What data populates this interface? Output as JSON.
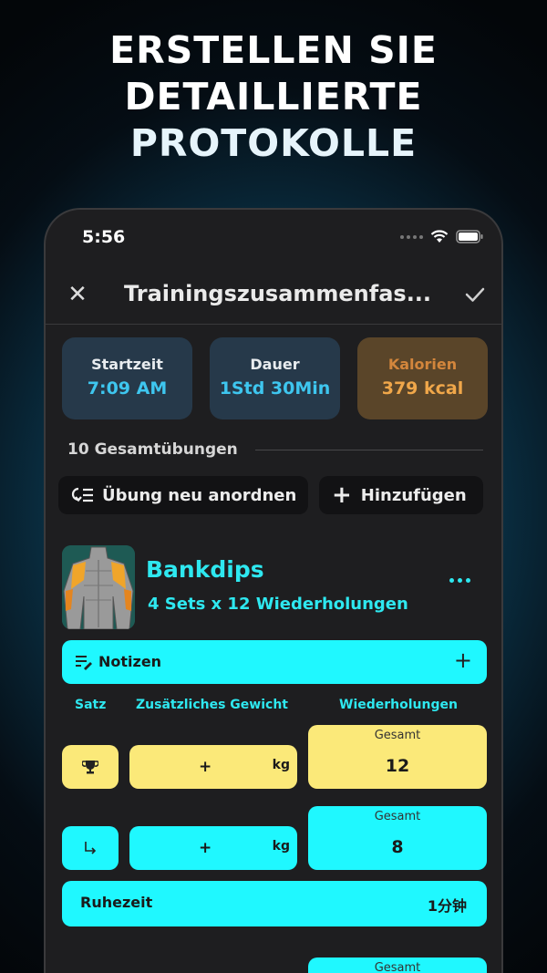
{
  "headline": {
    "line1": "ERSTELLEN SIE",
    "line2": "DETAILLIERTE",
    "line3": "PROTOKOLLE"
  },
  "status_bar": {
    "time": "5:56"
  },
  "nav": {
    "title": "Trainingszusammenfas..."
  },
  "stats": [
    {
      "label": "Startzeit",
      "value": "7:09 AM"
    },
    {
      "label": "Dauer",
      "value": "1Std 30Min"
    },
    {
      "label": "Kalorien",
      "value": "379 kcal"
    }
  ],
  "section_title": "10 Gesamtübungen",
  "actions": {
    "reorder_label": "Übung neu anordnen",
    "add_label": "Hinzufügen"
  },
  "exercise": {
    "name": "Bankdips",
    "sets_summary": "4 Sets x 12 Wiederholungen",
    "notes_label": "Notizen",
    "columns": {
      "set": "Satz",
      "weight": "Zusätzliches Gewicht",
      "reps": "Wiederholungen"
    },
    "sets": [
      {
        "type_icon": "trophy-icon",
        "weight_placeholder": "+",
        "unit": "kg",
        "reps_label": "Gesamt",
        "reps": "12",
        "color": "#fbe979"
      },
      {
        "type_icon": "sub-arrow-icon",
        "weight_placeholder": "+",
        "unit": "kg",
        "reps_label": "Gesamt",
        "reps": "8",
        "color": "#1ff8ff"
      }
    ],
    "rest": {
      "label": "Ruhezeit",
      "value": "1分钟"
    },
    "next_set_reps_label": "Gesamt"
  },
  "colors": {
    "accent_cyan": "#1ff8ff",
    "highlight_yellow": "#fbe979",
    "calories_orange": "#f0a74a",
    "stat_blue": "#3ec6ef"
  }
}
